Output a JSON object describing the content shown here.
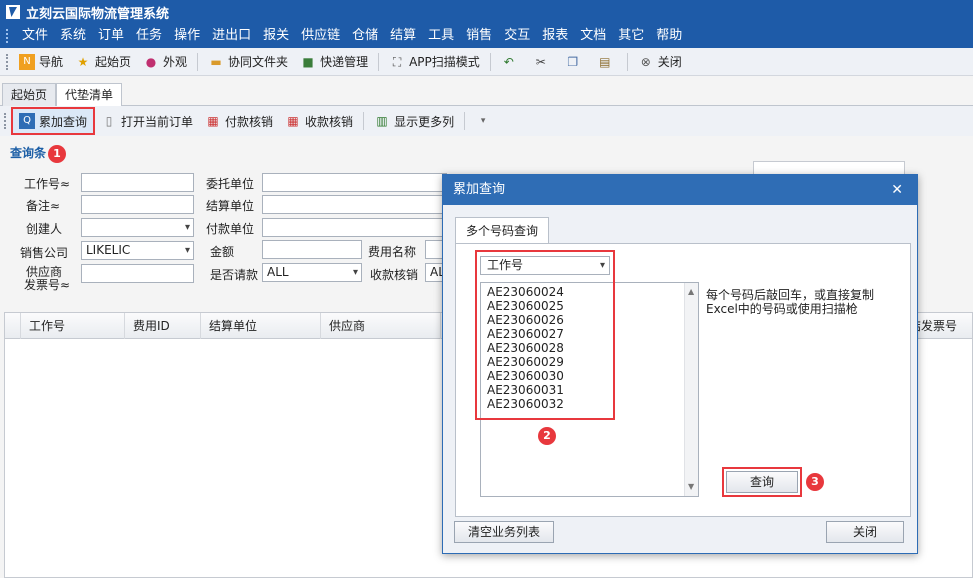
{
  "app": {
    "title": "立刻云国际物流管理系统"
  },
  "menu": [
    "文件",
    "系统",
    "订单",
    "任务",
    "操作",
    "进出口",
    "报关",
    "供应链",
    "仓储",
    "结算",
    "工具",
    "销售",
    "交互",
    "报表",
    "文档",
    "其它",
    "帮助"
  ],
  "toolbar": {
    "nav": "导航",
    "home": "起始页",
    "external": "外观",
    "shared_folder": "协同文件夹",
    "express": "快递管理",
    "app_scan": "APP扫描模式",
    "close": "关闭"
  },
  "tabs": {
    "start": "起始页",
    "current": "代垫清单"
  },
  "subtoolbar": {
    "cumulative_query": "累加查询",
    "open_order": "打开当前订单",
    "pay_verify": "付款核销",
    "receive_verify": "收款核销",
    "show_more": "显示更多列"
  },
  "section_title": "查询条",
  "callouts": [
    "1",
    "2",
    "3"
  ],
  "form": {
    "job_no": "工作号≈",
    "remark": "备注≈",
    "creator": "创建人",
    "sales_company": "销售公司",
    "sales_company_value": "LIKELIC",
    "supplier_invoice_1": "供应商",
    "supplier_invoice_2": "发票号≈",
    "client": "委托单位",
    "settle_unit": "结算单位",
    "pay_unit": "付款单位",
    "amount": "金额",
    "fee_name": "费用名称",
    "is_requested": "是否请款",
    "is_requested_value": "ALL",
    "receive_verify": "收款核销",
    "receive_verify_value": "AL"
  },
  "grid": {
    "columns": [
      "工作号",
      "费用ID",
      "结算单位",
      "供应商"
    ],
    "right_column": "结发票号"
  },
  "modal": {
    "title": "累加查询",
    "tab": "多个号码查询",
    "field_select": "工作号",
    "numbers": [
      "AE23060024",
      "AE23060025",
      "AE23060026",
      "AE23060027",
      "AE23060028",
      "AE23060029",
      "AE23060030",
      "AE23060031",
      "AE23060032"
    ],
    "hint": "每个号码后敲回车，或直接复制Excel中的号码或使用扫描枪",
    "query_button": "查询",
    "clear_button": "清空业务列表",
    "close_button": "关闭"
  }
}
